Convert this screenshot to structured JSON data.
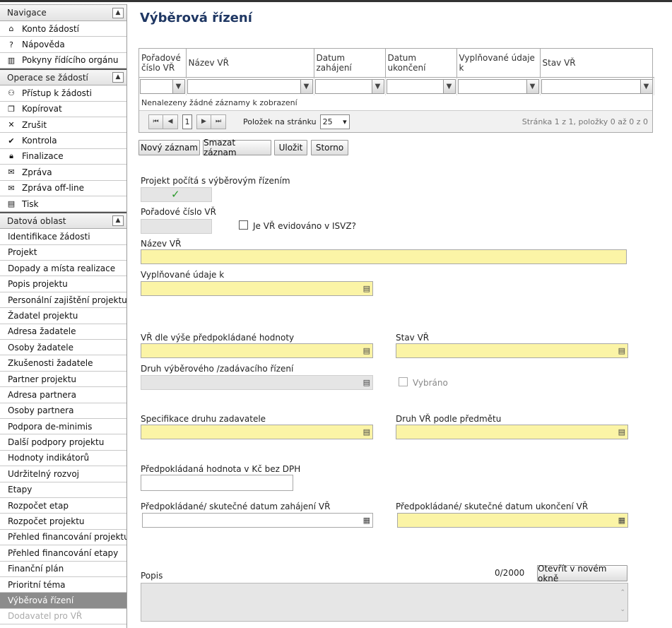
{
  "sidebar": {
    "nav_header": "Navigace",
    "nav_items": [
      {
        "icon": "home-icon",
        "glyph": "⌂",
        "label": "Konto žádostí"
      },
      {
        "icon": "help-icon",
        "glyph": "?",
        "label": "Nápověda"
      },
      {
        "icon": "book-icon",
        "glyph": "▥",
        "label": "Pokyny řídícího orgánu"
      }
    ],
    "ops_header": "Operace se žádostí",
    "ops_items": [
      {
        "icon": "user-icon",
        "glyph": "⚇",
        "label": "Přístup k žádosti"
      },
      {
        "icon": "copy-icon",
        "glyph": "❐",
        "label": "Kopírovat"
      },
      {
        "icon": "close-icon",
        "glyph": "✕",
        "label": "Zrušit"
      },
      {
        "icon": "check-icon",
        "glyph": "✔",
        "label": "Kontrola"
      },
      {
        "icon": "lock-icon",
        "glyph": "🔒︎",
        "label": "Finalizace"
      },
      {
        "icon": "mail-icon",
        "glyph": "✉",
        "label": "Zpráva"
      },
      {
        "icon": "mail-icon",
        "glyph": "✉",
        "label": "Zpráva off-line"
      },
      {
        "icon": "print-icon",
        "glyph": "▤",
        "label": "Tisk"
      }
    ],
    "data_header": "Datová oblast",
    "data_items": [
      "Identifikace žádosti",
      "Projekt",
      "Dopady a místa realizace",
      "Popis projektu",
      "Personální zajištění projektu",
      "Žadatel projektu",
      "Adresa žadatele",
      "Osoby žadatele",
      "Zkušenosti žadatele",
      "Partner projektu",
      "Adresa partnera",
      "Osoby partnera",
      "Podpora de-minimis",
      "Další podpory projektu",
      "Hodnoty indikátorů",
      "Udržitelný rozvoj",
      "Etapy",
      "Rozpočet etap",
      "Rozpočet projektu",
      "Přehled financování projektu",
      "Přehled financování etapy",
      "Finanční plán",
      "Prioritní téma",
      "Výběrová řízení",
      "Dodavatel pro VŘ"
    ],
    "active_item": "Výběrová řízení",
    "disabled_item": "Dodavatel pro VŘ"
  },
  "main": {
    "title": "Výběrová řízení",
    "grid": {
      "columns": [
        "Pořadové číslo VŘ",
        "Název VŘ",
        "Datum zahájení",
        "Datum ukončení",
        "Vyplňované údaje k",
        "Stav VŘ"
      ],
      "empty_message": "Nenalezeny žádné záznamy k zobrazení",
      "current_page": "1",
      "page_size_label": "Položek na stránku",
      "page_size": "25",
      "pager_info": "Stránka 1 z 1, položky 0 až 0 z 0"
    },
    "buttons": {
      "new": "Nový záznam",
      "delete": "Smazat záznam",
      "save": "Uložit",
      "cancel": "Storno"
    },
    "form": {
      "project_counts_label": "Projekt počítá s výběrovým řízením",
      "order_number_label": "Pořadové číslo VŘ",
      "isvz_label": "Je VŘ evidováno v ISVZ?",
      "name_label": "Název VŘ",
      "filled_for_label": "Vyplňované údaje k",
      "by_value_label": "VŘ dle výše předpokládané hodnoty",
      "status_label": "Stav VŘ",
      "procedure_type_label": "Druh výběrového /zadávacího řízení",
      "selected_label": "Vybráno",
      "contracting_spec_label": "Specifikace druhu zadavatele",
      "subject_type_label": "Druh VŘ podle předmětu",
      "expected_value_label": "Předpokládaná hodnota v Kč bez DPH",
      "start_date_label": "Předpokládané/ skutečné datum zahájení VŘ",
      "end_date_label": "Předpokládané/ skutečné datum ukončení VŘ",
      "description_label": "Popis",
      "char_count": "0/2000",
      "open_new_window": "Otevřít v novém okně"
    }
  }
}
